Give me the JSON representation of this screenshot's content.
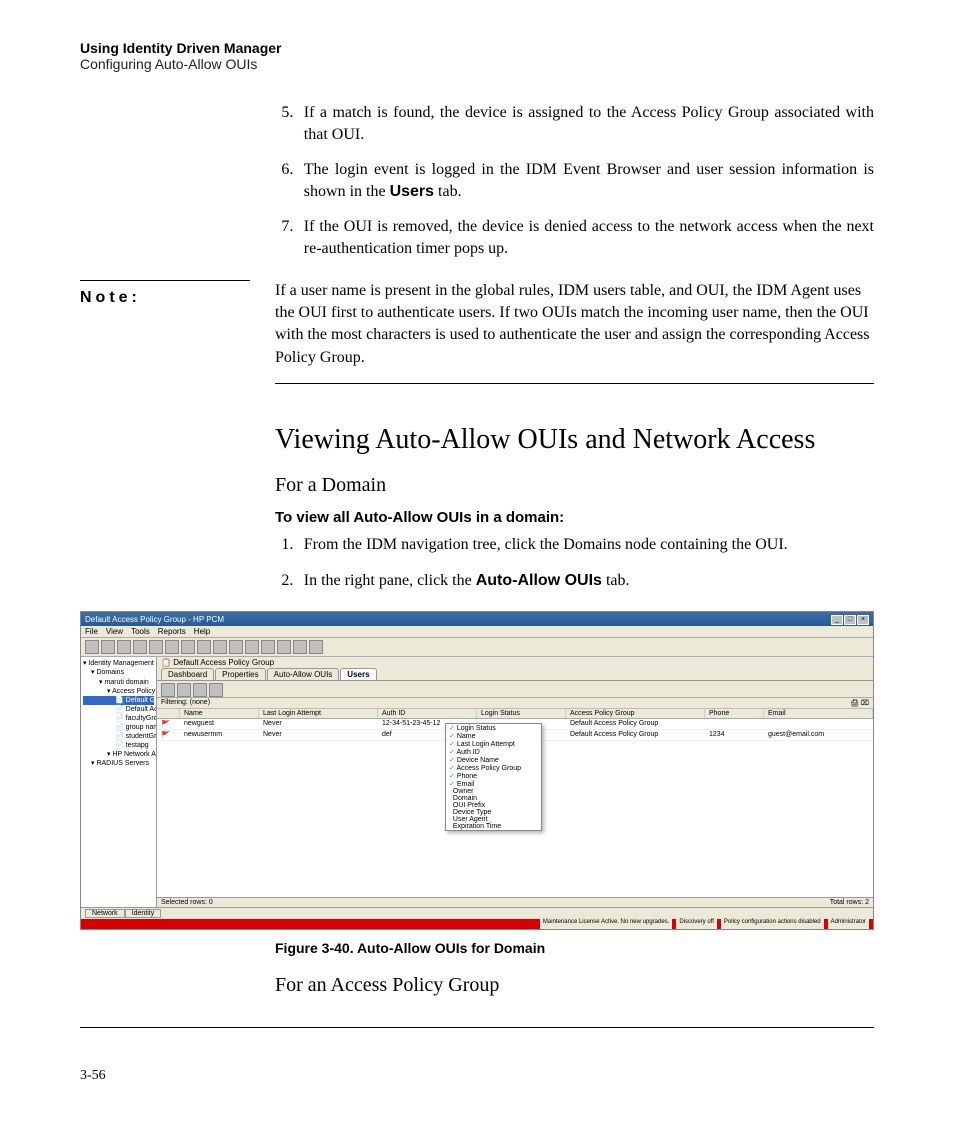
{
  "runningHeader": {
    "title": "Using Identity Driven Manager",
    "subtitle": "Configuring Auto-Allow OUIs"
  },
  "list1": {
    "start": 5,
    "items": [
      {
        "pre": "If a match is found, the device is assigned to the Access Policy Group associated with that OUI.",
        "bold": "",
        "post": ""
      },
      {
        "pre": "The login event is logged in the IDM Event Browser and user session information is shown in the ",
        "bold": "Users",
        "post": " tab."
      },
      {
        "pre": "If the OUI is removed, the device is denied access to the network access when the next re-authentication timer pops up.",
        "bold": "",
        "post": ""
      }
    ]
  },
  "note": {
    "label": "Note:",
    "body": "If a user name is present in the global rules, IDM users table, and OUI, the IDM Agent uses the OUI first to authenticate users. If two OUIs match the incoming user name, then the OUI with the most characters is used to authenticate the user and assign the corresponding Access Policy Group."
  },
  "sectionTitle": "Viewing Auto-Allow OUIs and Network Access",
  "sub1": "For a Domain",
  "boldPara1": "To view all Auto-Allow OUIs in a domain:",
  "list2": {
    "start": 1,
    "items": [
      {
        "pre": "From the IDM navigation tree, click the Domains node containing the OUI.",
        "bold": "",
        "post": ""
      },
      {
        "pre": "In the right pane, click the ",
        "bold": "Auto-Allow OUIs",
        "post": " tab."
      }
    ]
  },
  "screenshot": {
    "windowTitle": "Default Access Policy Group - HP PCM",
    "menu": [
      "File",
      "View",
      "Tools",
      "Reports",
      "Help"
    ],
    "tree": {
      "root": "Identity Management Home",
      "items": [
        {
          "label": "Domains",
          "indent": 1
        },
        {
          "label": "maruti domain",
          "indent": 2
        },
        {
          "label": "Access Policy Groups",
          "indent": 3
        },
        {
          "label": "Default Guest Access Po",
          "indent": 4,
          "selected": true
        },
        {
          "label": "Default Access Policy Group",
          "indent": 4
        },
        {
          "label": "facultyGroup",
          "indent": 4
        },
        {
          "label": "group name",
          "indent": 4
        },
        {
          "label": "studentGroup",
          "indent": 4
        },
        {
          "label": "testapg",
          "indent": 4
        },
        {
          "label": "HP Network Access Control",
          "indent": 3
        },
        {
          "label": "RADIUS Servers",
          "indent": 1
        }
      ]
    },
    "panelTitle": "Default Access Policy Group",
    "tabs": [
      "Dashboard",
      "Properties",
      "Auto-Allow OUIs",
      "Users"
    ],
    "activeTab": "Users",
    "filterLabel": "Filtering: (none)",
    "columns": [
      "",
      "Name",
      "Last Login Attempt",
      "Auth ID",
      "Login Status",
      "Access Policy Group",
      "Phone",
      "Email"
    ],
    "rows": [
      {
        "name": "newguest",
        "lla": "Never",
        "auth": "12-34-51-23-45-12",
        "login": "",
        "apg": "Default Access Policy Group",
        "phone": "",
        "email": ""
      },
      {
        "name": "newusermm",
        "lla": "Never",
        "auth": "def",
        "login": "",
        "apg": "Default Access Policy Group",
        "phone": "1234",
        "email": "guest@email.com"
      }
    ],
    "popup": [
      {
        "label": "Login Status",
        "checked": true
      },
      {
        "label": "Name",
        "checked": true
      },
      {
        "label": "Last Login Attempt",
        "checked": true
      },
      {
        "label": "Auth ID",
        "checked": true
      },
      {
        "label": "Device Name",
        "checked": true
      },
      {
        "label": "Access Policy Group",
        "checked": true
      },
      {
        "label": "Phone",
        "checked": true
      },
      {
        "label": "Email",
        "checked": true
      },
      {
        "label": "Owner",
        "checked": false
      },
      {
        "label": "Domain",
        "checked": false
      },
      {
        "label": "OUI Prefix",
        "checked": false
      },
      {
        "label": "Device Type",
        "checked": false
      },
      {
        "label": "User Agent",
        "checked": false
      },
      {
        "label": "Expiration Time",
        "checked": false
      }
    ],
    "bottomTabs": [
      "Network",
      "Identity"
    ],
    "selectedRows": "Selected rows: 0",
    "totalRows": "Total rows: 2",
    "status": [
      "Maintenance License Active. No new upgrades.",
      "Discovery off",
      "Policy configuration actions disabled",
      "Administrator"
    ]
  },
  "figCaption": "Figure 3-40. Auto-Allow OUIs for Domain",
  "sub2": "For an Access Policy Group",
  "pageNum": "3-56"
}
